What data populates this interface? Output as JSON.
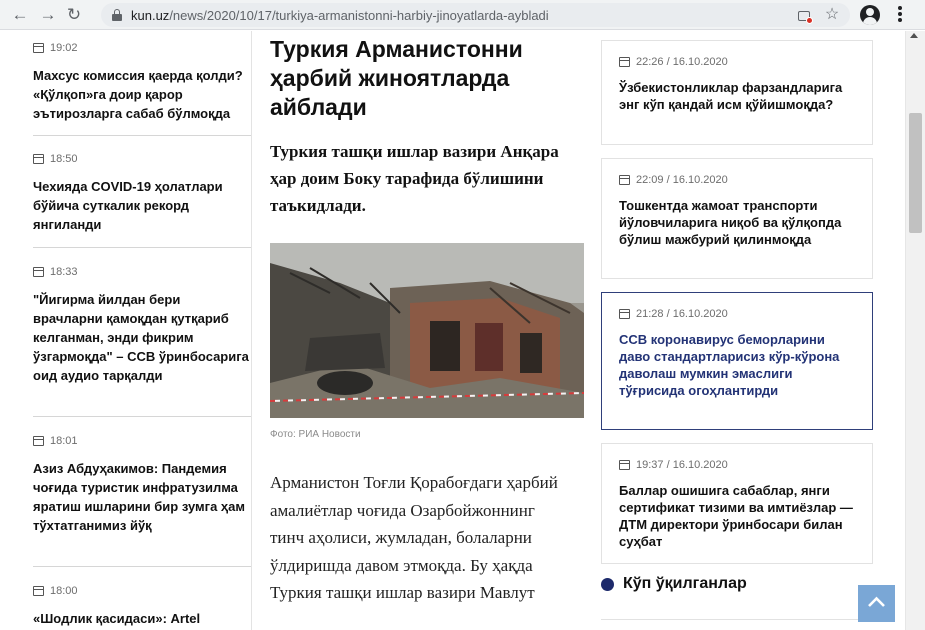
{
  "browser": {
    "url_host": "kun.uz",
    "url_path": "/news/2020/10/17/turkiya-armanistonni-harbiy-jinoyatlarda-aybladi"
  },
  "left_feed": [
    {
      "time": "19:02",
      "title": "Махсус комиссия қаерда қолди? «Қўлқоп»га доир қарор эътирозларга сабаб бўлмоқда"
    },
    {
      "time": "18:50",
      "title": "Чехияда COVID-19 ҳолатлари бўйича суткалик рекорд янгиланди"
    },
    {
      "time": "18:33",
      "title": "\"Йигирма йилдан бери врачларни қамоқдан қутқариб келганман, энди фикрим ўзгармоқда\" – ССВ ўринбосарига оид аудио тарқалди"
    },
    {
      "time": "18:01",
      "title": "Азиз Абдуҳакимов: Пандемия чоғида туристик инфратузилма яратиш ишларини бир зумга ҳам тўхтатганимиз йўқ"
    },
    {
      "time": "18:00",
      "title": "«Шодлик қасидаси»: Artel"
    }
  ],
  "article": {
    "headline": "Туркия Арманистонни ҳарбий жиноятларда айблади",
    "lead": "Туркия ташқи ишлар вазири Анқара ҳар доим Боку тарафида бўлишини таъкидлади.",
    "photo_caption": "Фото: РИА Новости",
    "body": "Арманистон Тоғли Қорабоғдаги ҳарбий амалиётлар чоғида Озарбойжоннинг тинч аҳолиси, жумладан, болаларни ўлдиришда давом этмоқда. Бу ҳақда Туркия ташқи ишлар вазири Мавлут"
  },
  "right_cards": [
    {
      "time": "22:26 / 16.10.2020",
      "title": "Ўзбекистонликлар фарзандларига энг кўп қандай исм қўйишмоқда?"
    },
    {
      "time": "22:09 / 16.10.2020",
      "title": "Тошкентда жамоат транспорти йўловчиларига ниқоб ва қўлқопда бўлиш мажбурий қилинмоқда"
    },
    {
      "time": "21:28 / 16.10.2020",
      "title": "ССВ коронавирус беморларини даво стандартларисиз кўр-кўрона даволаш мумкин эмаслиги тўғрисида огоҳлантирди"
    },
    {
      "time": "19:37 / 16.10.2020",
      "title": "Баллар ошишига сабаблар, янги сертификат тизими ва имтиёзлар — ДТМ директори ўринбосари билан суҳбат"
    }
  ],
  "popular": {
    "title": "Кўп ўқилганлар"
  },
  "colors": {
    "accent": "#233376",
    "bullet": "#1d2a6b",
    "to_top": "#7aa7d6"
  },
  "icons": [
    "back-arrow-icon",
    "forward-arrow-icon",
    "reload-icon",
    "lock-icon",
    "cast-icon",
    "star-icon",
    "profile-icon",
    "menu-icon",
    "calendar-icon",
    "chevron-up-icon"
  ]
}
